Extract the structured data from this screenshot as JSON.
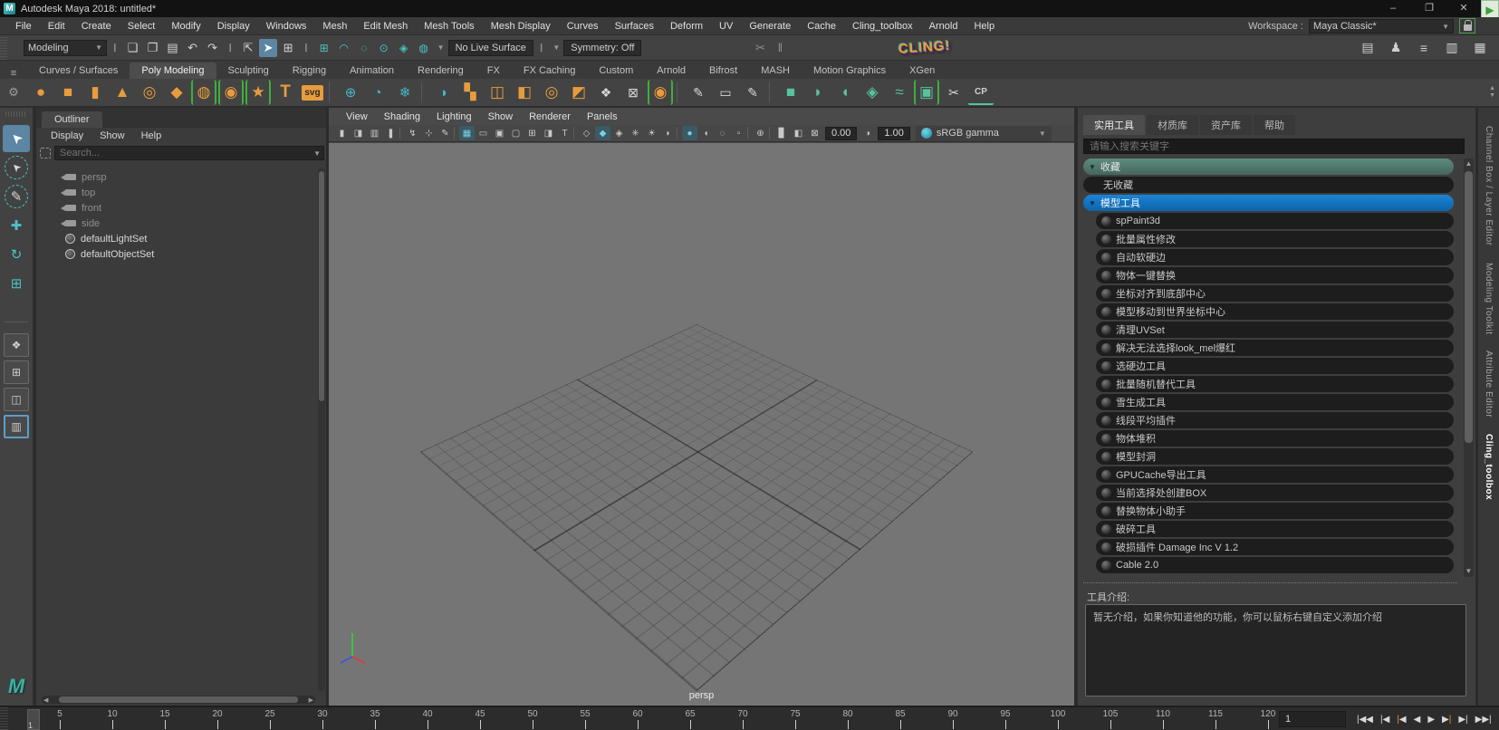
{
  "window": {
    "badge": "M",
    "title": "Autodesk Maya 2018: untitled*",
    "minimize": "–",
    "restore": "❐",
    "close": "✕",
    "rec": "▶"
  },
  "menubar": {
    "items": [
      "File",
      "Edit",
      "Create",
      "Select",
      "Modify",
      "Display",
      "Windows",
      "Mesh",
      "Edit Mesh",
      "Mesh Tools",
      "Mesh Display",
      "Curves",
      "Surfaces",
      "Deform",
      "UV",
      "Generate",
      "Cache",
      "Cling_toolbox",
      "Arnold",
      "Help"
    ],
    "workspace_label": "Workspace :",
    "workspace_value": "Maya Classic*"
  },
  "statusline": {
    "mode": "Modeling",
    "file_icons": [
      {
        "name": "new-scene-icon",
        "glyph": "❏"
      },
      {
        "name": "open-scene-icon",
        "glyph": "❐"
      },
      {
        "name": "save-scene-icon",
        "glyph": "▤"
      },
      {
        "name": "undo-icon",
        "glyph": "↶"
      },
      {
        "name": "redo-icon",
        "glyph": "↷"
      }
    ],
    "select_icons": [
      {
        "name": "select-hierarchy-icon",
        "glyph": "⇱",
        "active": "0"
      },
      {
        "name": "select-object-icon",
        "glyph": "➤",
        "active": "1"
      },
      {
        "name": "select-component-icon",
        "glyph": "⊞",
        "active": "0"
      }
    ],
    "snap_icons": [
      {
        "name": "snap-to-grid-icon",
        "glyph": "⊞"
      },
      {
        "name": "snap-to-curve-icon",
        "glyph": "◠"
      },
      {
        "name": "snap-to-point-icon",
        "glyph": "◌"
      },
      {
        "name": "snap-to-projected-center-icon",
        "glyph": "⊙"
      },
      {
        "name": "snap-to-view-plane-icon",
        "glyph": "◈"
      },
      {
        "name": "make-live-icon",
        "glyph": "◍"
      }
    ],
    "no_live_surface": "No Live Surface",
    "symmetry": "Symmetry: Off",
    "mid_icons": [
      {
        "name": "construction-history-icon",
        "glyph": "✂"
      },
      {
        "name": "pause-icon",
        "glyph": "‖"
      }
    ],
    "cling": "CLING!",
    "right_icons": [
      {
        "name": "modeling-toolkit-toggle-icon",
        "glyph": "▤"
      },
      {
        "name": "character-controls-icon",
        "glyph": "♟"
      },
      {
        "name": "tool-settings-toggle-icon",
        "glyph": "≡"
      },
      {
        "name": "attribute-editor-toggle-icon",
        "glyph": "▥"
      },
      {
        "name": "channel-box-toggle-icon",
        "glyph": "▦"
      }
    ]
  },
  "shelf": {
    "tabs": [
      {
        "label": "Curves / Surfaces",
        "active": "0"
      },
      {
        "label": "Poly Modeling",
        "active": "1"
      },
      {
        "label": "Sculpting",
        "active": "0"
      },
      {
        "label": "Rigging",
        "active": "0"
      },
      {
        "label": "Animation",
        "active": "0"
      },
      {
        "label": "Rendering",
        "active": "0"
      },
      {
        "label": "FX",
        "active": "0"
      },
      {
        "label": "FX Caching",
        "active": "0"
      },
      {
        "label": "Custom",
        "active": "0"
      },
      {
        "label": "Arnold",
        "active": "0"
      },
      {
        "label": "Bifrost",
        "active": "0"
      },
      {
        "label": "MASH",
        "active": "0"
      },
      {
        "label": "Motion Graphics",
        "active": "0"
      },
      {
        "label": "XGen",
        "active": "0"
      }
    ],
    "icons": [
      {
        "name": "poly-sphere-icon",
        "glyph": "●",
        "kind": "orange",
        "br": "0"
      },
      {
        "name": "poly-cube-icon",
        "glyph": "■",
        "kind": "orange",
        "br": "0"
      },
      {
        "name": "poly-cylinder-icon",
        "glyph": "▮",
        "kind": "orange",
        "br": "0"
      },
      {
        "name": "poly-cone-icon",
        "glyph": "▲",
        "kind": "orange",
        "br": "0"
      },
      {
        "name": "poly-torus-icon",
        "glyph": "◎",
        "kind": "orange",
        "br": "0"
      },
      {
        "name": "poly-plane-icon",
        "glyph": "◆",
        "kind": "orange",
        "br": "0"
      },
      {
        "name": "poly-disc-icon",
        "glyph": "◍",
        "kind": "orange",
        "br": "1"
      },
      {
        "name": "platonic-solid-icon",
        "glyph": "◉",
        "kind": "orange",
        "br": "1"
      },
      {
        "name": "super-shape-icon",
        "glyph": "★",
        "kind": "orange",
        "br": "1"
      },
      {
        "name": "type-tool-icon",
        "glyph": "T",
        "kind": "textorange",
        "br": "0"
      },
      {
        "name": "svg-tool-icon",
        "glyph": "svg",
        "kind": "svgbox",
        "br": "0"
      },
      {
        "name": "shelf-divider",
        "glyph": "",
        "kind": "divider",
        "br": "0"
      },
      {
        "name": "construction-plane-icon",
        "glyph": "⊕",
        "kind": "teal",
        "br": "0"
      },
      {
        "name": "reset-transform-icon",
        "glyph": "◔",
        "kind": "teal",
        "br": "0"
      },
      {
        "name": "center-origin-icon",
        "glyph": "❄",
        "kind": "teal",
        "br": "0"
      },
      {
        "name": "shelf-divider",
        "glyph": "",
        "kind": "divider",
        "br": "0"
      },
      {
        "name": "combine-icon",
        "glyph": "◑",
        "kind": "teal",
        "br": "0"
      },
      {
        "name": "separate-icon",
        "glyph": "▚",
        "kind": "orange",
        "br": "0"
      },
      {
        "name": "extract-icon",
        "glyph": "◫",
        "kind": "orange",
        "br": "0"
      },
      {
        "name": "duplicate-face-icon",
        "glyph": "◧",
        "kind": "orange",
        "br": "0"
      },
      {
        "name": "smooth-icon",
        "glyph": "◎",
        "kind": "orange",
        "br": "0"
      },
      {
        "name": "reduce-icon",
        "glyph": "◩",
        "kind": "orange",
        "br": "0"
      },
      {
        "name": "wedge-icon",
        "glyph": "❖",
        "kind": "gray",
        "br": "0"
      },
      {
        "name": "mirror-icon",
        "glyph": "⊠",
        "kind": "gray",
        "br": "0"
      },
      {
        "name": "remesh-sphere-icon",
        "glyph": "◉",
        "kind": "orange",
        "br": "1"
      },
      {
        "name": "shelf-divider",
        "glyph": "",
        "kind": "divider",
        "br": "0"
      },
      {
        "name": "knife-tool-icon",
        "glyph": "✎",
        "kind": "gray",
        "br": "0"
      },
      {
        "name": "quad-draw-icon",
        "glyph": "▭",
        "kind": "gray",
        "br": "0"
      },
      {
        "name": "multi-cut-icon",
        "glyph": "✎",
        "kind": "gray",
        "br": "0"
      },
      {
        "name": "shelf-divider",
        "glyph": "",
        "kind": "divider",
        "br": "0"
      },
      {
        "name": "boolean-union-icon",
        "glyph": "■",
        "kind": "mint",
        "br": "0"
      },
      {
        "name": "boolean-difference-icon",
        "glyph": "◗",
        "kind": "mint",
        "br": "0"
      },
      {
        "name": "boolean-intersection-icon",
        "glyph": "◖",
        "kind": "mint",
        "br": "0"
      },
      {
        "name": "remesh-cube-icon",
        "glyph": "◈",
        "kind": "mint",
        "br": "0"
      },
      {
        "name": "retopologize-icon",
        "glyph": "≈",
        "kind": "mint",
        "br": "0"
      },
      {
        "name": "pattern-grid-icon",
        "glyph": "▣",
        "kind": "mint",
        "br": "1"
      },
      {
        "name": "cut-scissors-icon",
        "glyph": "✂",
        "kind": "gray",
        "br": "0"
      },
      {
        "name": "cp-tool-icon",
        "glyph": "CP",
        "kind": "cp",
        "br": "0"
      }
    ]
  },
  "toolbox": {
    "tools": [
      {
        "name": "select-tool",
        "glyph": "➤",
        "kind": "cursor",
        "active": "1"
      },
      {
        "name": "lasso-select-tool",
        "glyph": "➤",
        "kind": "cursor-dashed",
        "active": "0"
      },
      {
        "name": "paint-select-tool",
        "glyph": "✎",
        "kind": "dashed",
        "active": "0"
      },
      {
        "name": "move-tool",
        "glyph": "✚",
        "kind": "teal",
        "active": "0"
      },
      {
        "name": "rotate-tool",
        "glyph": "↻",
        "kind": "teal",
        "active": "0"
      },
      {
        "name": "scale-tool",
        "glyph": "⊞",
        "kind": "teal",
        "active": "0"
      }
    ],
    "layouts": [
      {
        "name": "single-pane-layout-button",
        "glyph": "❖",
        "active": "0"
      },
      {
        "name": "four-pane-layout-button",
        "glyph": "⊞",
        "active": "0"
      },
      {
        "name": "two-pane-layout-button",
        "glyph": "◫",
        "active": "0"
      },
      {
        "name": "custom-pane-layout-button",
        "glyph": "▥",
        "active": "1"
      }
    ],
    "logo": "M"
  },
  "outliner": {
    "tab": "Outliner",
    "menus": [
      "Display",
      "Show",
      "Help"
    ],
    "search_placeholder": "Search...",
    "items": [
      {
        "label": "persp",
        "icon": "camera",
        "muted": "1"
      },
      {
        "label": "top",
        "icon": "camera",
        "muted": "1"
      },
      {
        "label": "front",
        "icon": "camera",
        "muted": "1"
      },
      {
        "label": "side",
        "icon": "camera",
        "muted": "1"
      },
      {
        "label": "defaultLightSet",
        "icon": "set",
        "muted": "0"
      },
      {
        "label": "defaultObjectSet",
        "icon": "set",
        "muted": "0"
      }
    ]
  },
  "viewport": {
    "menus": [
      "View",
      "Shading",
      "Lighting",
      "Show",
      "Renderer",
      "Panels"
    ],
    "icons": [
      {
        "name": "select-camera-icon",
        "glyph": "▮",
        "kind": "ico",
        "state": "off"
      },
      {
        "name": "lock-camera-icon",
        "glyph": "◨",
        "kind": "ico",
        "state": "off"
      },
      {
        "name": "camera-attributes-icon",
        "glyph": "▥",
        "kind": "ico",
        "state": "off"
      },
      {
        "name": "bookmark-icon",
        "glyph": "❚",
        "kind": "ico",
        "state": "off"
      },
      {
        "name": "vp-divider",
        "glyph": "",
        "kind": "divider",
        "state": "off"
      },
      {
        "name": "image-plane-icon",
        "glyph": "↯",
        "kind": "ico",
        "state": "off"
      },
      {
        "name": "pan-zoom-icon",
        "glyph": "⊹",
        "kind": "ico",
        "state": "off"
      },
      {
        "name": "grease-pencil-icon",
        "glyph": "✎",
        "kind": "ico",
        "state": "off"
      },
      {
        "name": "vp-divider",
        "glyph": "",
        "kind": "divider",
        "state": "off"
      },
      {
        "name": "grid-toggle-icon",
        "glyph": "▦",
        "kind": "ico",
        "state": "on"
      },
      {
        "name": "film-gate-icon",
        "glyph": "▭",
        "kind": "ico",
        "state": "off"
      },
      {
        "name": "resolution-gate-icon",
        "glyph": "▣",
        "kind": "ico",
        "state": "off"
      },
      {
        "name": "gate-mask-icon",
        "glyph": "▢",
        "kind": "ico",
        "state": "off"
      },
      {
        "name": "field-chart-icon",
        "glyph": "⊞",
        "kind": "ico",
        "state": "off"
      },
      {
        "name": "safe-action-icon",
        "glyph": "◨",
        "kind": "ico",
        "state": "off"
      },
      {
        "name": "safe-title-icon",
        "glyph": "T",
        "kind": "ico",
        "state": "off"
      },
      {
        "name": "vp-divider",
        "glyph": "",
        "kind": "divider",
        "state": "off"
      },
      {
        "name": "wireframe-icon",
        "glyph": "◇",
        "kind": "ico",
        "state": "off"
      },
      {
        "name": "smooth-shade-icon",
        "glyph": "◆",
        "kind": "ico",
        "state": "on"
      },
      {
        "name": "textured-icon",
        "glyph": "◈",
        "kind": "ico",
        "state": "off"
      },
      {
        "name": "use-all-lights-icon",
        "glyph": "✳",
        "kind": "ico",
        "state": "off"
      },
      {
        "name": "shadows-icon",
        "glyph": "☀",
        "kind": "ico",
        "state": "off"
      },
      {
        "name": "ambient-occlusion-icon",
        "glyph": "◗",
        "kind": "ico",
        "state": "off"
      },
      {
        "name": "vp-divider",
        "glyph": "",
        "kind": "divider",
        "state": "off"
      },
      {
        "name": "motion-blur-icon",
        "glyph": "●",
        "kind": "ico",
        "state": "on"
      },
      {
        "name": "multisample-icon",
        "glyph": "◖",
        "kind": "ico",
        "state": "off"
      },
      {
        "name": "depth-of-field-icon",
        "glyph": "◌",
        "kind": "ico",
        "state": "off"
      },
      {
        "name": "isolate-select-icon",
        "glyph": "▫",
        "kind": "ico",
        "state": "off"
      },
      {
        "name": "vp-divider",
        "glyph": "",
        "kind": "divider",
        "state": "off"
      },
      {
        "name": "xray-icon",
        "glyph": "⊕",
        "kind": "ico",
        "state": "off"
      },
      {
        "name": "vp-divider",
        "glyph": "",
        "kind": "divider",
        "state": "off"
      },
      {
        "name": "exposure-icon",
        "glyph": "▊",
        "kind": "ico",
        "state": "off"
      },
      {
        "name": "gamma-icon",
        "glyph": "◧",
        "kind": "ico",
        "state": "off"
      },
      {
        "name": "view-transform-icon",
        "glyph": "⊠",
        "kind": "ico",
        "state": "off"
      }
    ],
    "exposure": "0.00",
    "gamma": "1.00",
    "colorspace": "sRGB gamma",
    "camera": "persp"
  },
  "right_panel": {
    "tabs": [
      {
        "label": "实用工具",
        "active": "1"
      },
      {
        "label": "材质库",
        "active": "0"
      },
      {
        "label": "资产库",
        "active": "0"
      },
      {
        "label": "帮助",
        "active": "0"
      }
    ],
    "search_placeholder": "请输入搜索关键字",
    "tree": [
      {
        "kind": "fav-header",
        "label": "收藏"
      },
      {
        "kind": "plain",
        "label": "无收藏"
      },
      {
        "kind": "sel-header",
        "label": "模型工具"
      },
      {
        "kind": "tool",
        "label": "spPaint3d"
      },
      {
        "kind": "tool",
        "label": "批量属性修改"
      },
      {
        "kind": "tool",
        "label": "自动软硬边"
      },
      {
        "kind": "tool",
        "label": "物体一键替换"
      },
      {
        "kind": "tool",
        "label": "坐标对齐到底部中心"
      },
      {
        "kind": "tool",
        "label": "模型移动到世界坐标中心"
      },
      {
        "kind": "tool",
        "label": "清理UVSet"
      },
      {
        "kind": "tool",
        "label": "解决无法选择look_mel爆红"
      },
      {
        "kind": "tool",
        "label": "选硬边工具"
      },
      {
        "kind": "tool",
        "label": "批量随机替代工具"
      },
      {
        "kind": "tool",
        "label": "雪生成工具"
      },
      {
        "kind": "tool",
        "label": "线段平均插件"
      },
      {
        "kind": "tool",
        "label": "物体堆积"
      },
      {
        "kind": "tool",
        "label": "模型封洞"
      },
      {
        "kind": "tool",
        "label": "GPUCache导出工具"
      },
      {
        "kind": "tool",
        "label": "当前选择处创建BOX"
      },
      {
        "kind": "tool",
        "label": "替换物体小助手"
      },
      {
        "kind": "tool",
        "label": "破碎工具"
      },
      {
        "kind": "tool",
        "label": "破损插件 Damage Inc V 1.2"
      },
      {
        "kind": "tool",
        "label": "Cable 2.0"
      }
    ],
    "intro_label": "工具介绍:",
    "intro_text": "暂无介绍，如果你知道他的功能，你可以鼠标右键自定义添加介绍"
  },
  "side_tabs": [
    {
      "label": "Channel Box / Layer Editor",
      "active": "0"
    },
    {
      "label": "Modeling Toolkit",
      "active": "0"
    },
    {
      "label": "Attribute Editor",
      "active": "0"
    },
    {
      "label": "Cling_toolbox",
      "active": "1"
    }
  ],
  "timeline": {
    "ticks": [
      "5",
      "10",
      "15",
      "20",
      "25",
      "30",
      "35",
      "40",
      "45",
      "50",
      "55",
      "60",
      "65",
      "70",
      "75",
      "80",
      "85",
      "90",
      "95",
      "100",
      "105",
      "110",
      "115",
      "120"
    ],
    "current_frame": "1",
    "frame_field": "1",
    "playback": [
      {
        "name": "go-to-start-button",
        "l": "|◀",
        "la": "0",
        "r": "◀",
        "ra": "0"
      },
      {
        "name": "step-back-frame-button",
        "l": "|",
        "la": "0",
        "r": "◀",
        "ra": "0"
      },
      {
        "name": "step-back-key-button",
        "l": "|",
        "la": "1",
        "r": "◀",
        "ra": "0"
      },
      {
        "name": "play-backwards-button",
        "l": "",
        "la": "0",
        "r": "◀",
        "ra": "0"
      },
      {
        "name": "play-forwards-button",
        "l": "▶",
        "la": "0",
        "r": "",
        "ra": "0"
      },
      {
        "name": "step-forward-key-button",
        "l": "▶",
        "la": "0",
        "r": "|",
        "ra": "1"
      },
      {
        "name": "step-forward-frame-button",
        "l": "▶",
        "la": "0",
        "r": "|",
        "ra": "0"
      },
      {
        "name": "go-to-end-button",
        "l": "▶▶",
        "la": "0",
        "r": "|",
        "ra": "0"
      }
    ]
  }
}
